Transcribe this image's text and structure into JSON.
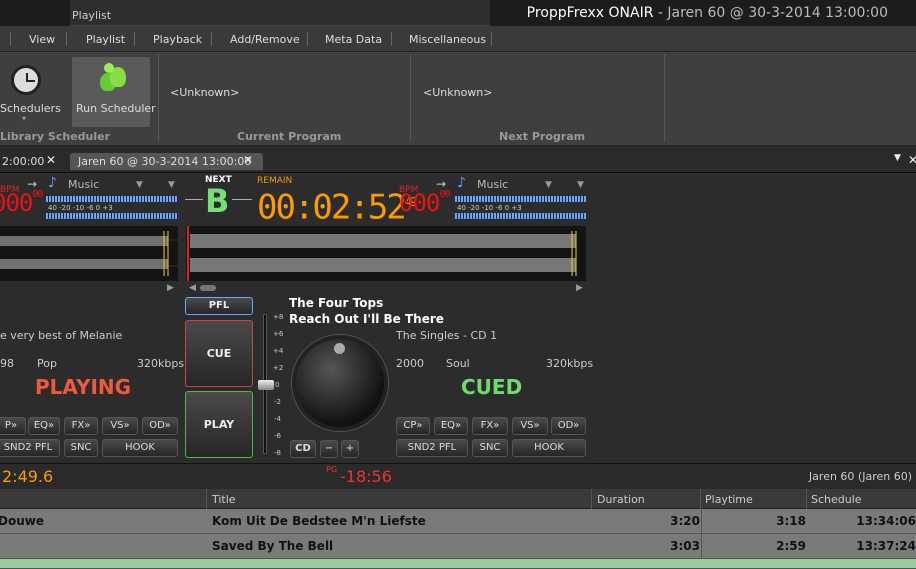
{
  "titlebar": {
    "tab_label": "Playlist",
    "app_name": "ProppFrexx ONAIR",
    "subtitle": " - Jaren 60 @ 30-3-2014 13:00:00"
  },
  "menu": [
    "View",
    "Playlist",
    "Playback",
    "Add/Remove",
    "Meta Data",
    "Miscellaneous"
  ],
  "ribbon": {
    "schedulers_label": "Schedulers",
    "run_scheduler_label": "Run Scheduler",
    "group_library_scheduler": "Library  Scheduler",
    "current_program_value": "<Unknown>",
    "current_program_label": "Current Program",
    "next_program_value": "<Unknown>",
    "next_program_label": "Next Program"
  },
  "tabs": {
    "tab1": "2:00:00",
    "tab2": "Jaren 60 @ 30-3-2014 13:00:00"
  },
  "deck": {
    "left": {
      "bpm_label": "BPM",
      "bpm_value": "000",
      "bpm_fraction": "00",
      "category": "Music",
      "album": "e very best of Melanie",
      "year": "98",
      "genre": "Pop",
      "bitrate": "320kbps",
      "state": "PLAYING",
      "vu_scale": "40  -20     -10  -6     0  +3"
    },
    "center": {
      "next_label": "NEXT",
      "next_letter": "B",
      "remain_label": "REMAIN",
      "remain_value": "00:02:52",
      "remain_fraction": "49",
      "pfl": "PFL",
      "cue": "CUE",
      "play": "PLAY",
      "artist": "The Four Tops",
      "title": "Reach Out I'll Be There",
      "cd": "CD",
      "minus": "−",
      "plus": "+",
      "fader_scale": [
        "+8",
        "+6",
        "+4",
        "+2",
        "0",
        "-2",
        "-4",
        "-6",
        "-8"
      ]
    },
    "right": {
      "bpm_label": "BPM",
      "bpm_value": "000",
      "bpm_fraction": "00",
      "category": "Music",
      "album": "The Singles - CD 1",
      "year": "2000",
      "genre": "Soul",
      "bitrate": "320kbps",
      "state": "CUED",
      "vu_scale": "40  -20     -10  -6     0  +3"
    },
    "buttons": {
      "cp": "CP»",
      "eq": "EQ»",
      "fx": "FX»",
      "vs": "VS»",
      "od": "OD»",
      "snd2pfl": "SND2 PFL",
      "snc": "SNC",
      "hook": "HOOK",
      "cp_left": "P»",
      "snd2pfl_left": "SND2 PFL"
    }
  },
  "statusbar": {
    "elapsed": "2:49.6",
    "pg_label": "PG",
    "pg_value": "-18:56",
    "playlist_name": "Jaren 60 (Jaren 60)"
  },
  "grid": {
    "headers": [
      "Title",
      "Duration",
      "Playtime",
      "Schedule"
    ],
    "rows": [
      {
        "artist": "Douwe",
        "title": "Kom Uit De Bedstee M'n Liefste",
        "duration": "3:20",
        "playtime": "3:18",
        "schedule": "13:34:06"
      },
      {
        "artist": "",
        "title": "Saved By The Bell",
        "duration": "3:03",
        "playtime": "2:59",
        "schedule": "13:37:24"
      }
    ]
  },
  "colors": {
    "playing": "#f05a3c",
    "cued": "#6fdc6f",
    "remain": "#ff9a00",
    "bpm": "#e81010"
  }
}
